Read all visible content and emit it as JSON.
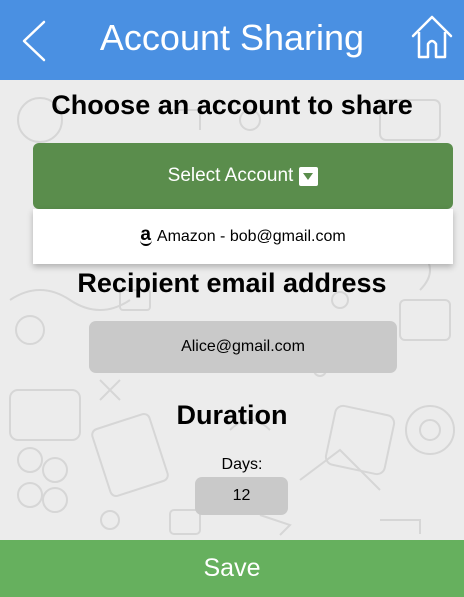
{
  "header": {
    "title": "Account Sharing",
    "back_icon": "chevron-left-icon",
    "home_icon": "home-icon",
    "color": "#4a90e2"
  },
  "account_section": {
    "heading": "Choose an account to share",
    "select_button_label": "Select Account",
    "select_button_color": "#5a8d4c",
    "options": [
      {
        "icon": "amazon-icon",
        "icon_glyph": "a",
        "label": "Amazon - bob@gmail.com"
      }
    ]
  },
  "recipient_section": {
    "heading": "Recipient email address",
    "email_value": "Alice@gmail.com"
  },
  "duration_section": {
    "heading": "Duration",
    "days_label": "Days:",
    "days_value": "12"
  },
  "footer": {
    "save_label": "Save",
    "save_color": "#66b05e"
  }
}
